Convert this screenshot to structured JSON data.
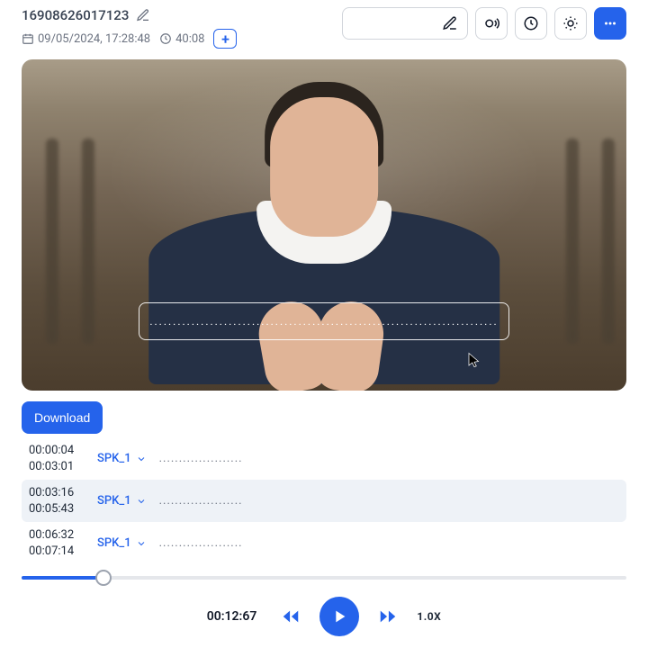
{
  "header": {
    "title": "16908626017123",
    "datetime": "09/05/2024, 17:28:48",
    "duration": "40:08"
  },
  "caption_placeholder": "...........................................................................",
  "download_label": "Download",
  "transcript": [
    {
      "start": "00:00:04",
      "end": "00:03:01",
      "speaker": "SPK_1",
      "text": "....................."
    },
    {
      "start": "00:03:16",
      "end": "00:05:43",
      "speaker": "SPK_1",
      "text": "....................."
    },
    {
      "start": "00:06:32",
      "end": "00:07:14",
      "speaker": "SPK_1",
      "text": "....................."
    }
  ],
  "playback": {
    "current": "00:12:67",
    "speed": "1.0X",
    "progress_pct": 13.5
  }
}
